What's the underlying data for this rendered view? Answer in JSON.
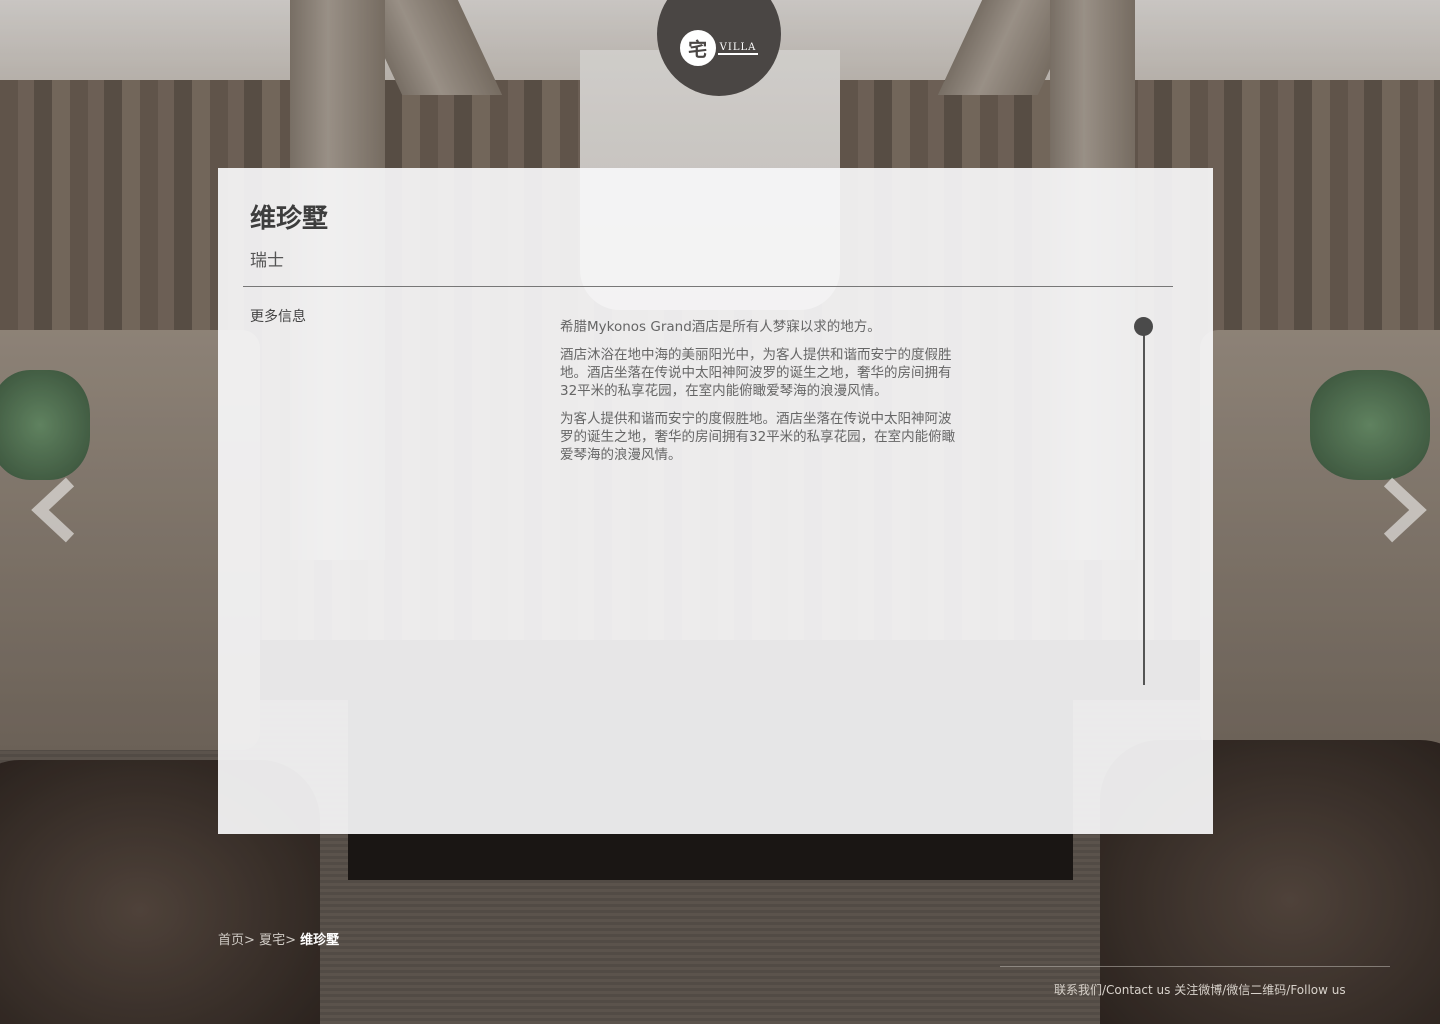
{
  "logo": {
    "glyph": "宅",
    "tag": "VILLA"
  },
  "property": {
    "name": "维珍墅",
    "location": "瑞士",
    "more_info_label": "更多信息",
    "description": [
      "希腊Mykonos Grand酒店是所有人梦寐以求的地方。",
      "酒店沐浴在地中海的美丽阳光中，为客人提供和谐而安宁的度假胜地。酒店坐落在传说中太阳神阿波罗的诞生之地，奢华的房间拥有32平米的私享花园，在室内能俯瞰爱琴海的浪漫风情。",
      "为客人提供和谐而安宁的度假胜地。酒店坐落在传说中太阳神阿波罗的诞生之地，奢华的房间拥有32平米的私享花园，在室内能俯瞰爱琴海的浪漫风情。"
    ]
  },
  "breadcrumb": {
    "home": "首页",
    "category": "夏宅",
    "current": "维珍墅",
    "separator": ">"
  },
  "footer": {
    "contact": "联系我们/Contact us",
    "follow": "关注微博/微信二维码/Follow us"
  },
  "icons": {
    "prev": "chevron-left-icon",
    "next": "chevron-right-icon"
  },
  "colors": {
    "logo_bg": "#4a4644",
    "card_bg": "#f6f6f8",
    "text_dark": "#3d3d3d",
    "scroll_thumb": "#4a4a4a"
  }
}
